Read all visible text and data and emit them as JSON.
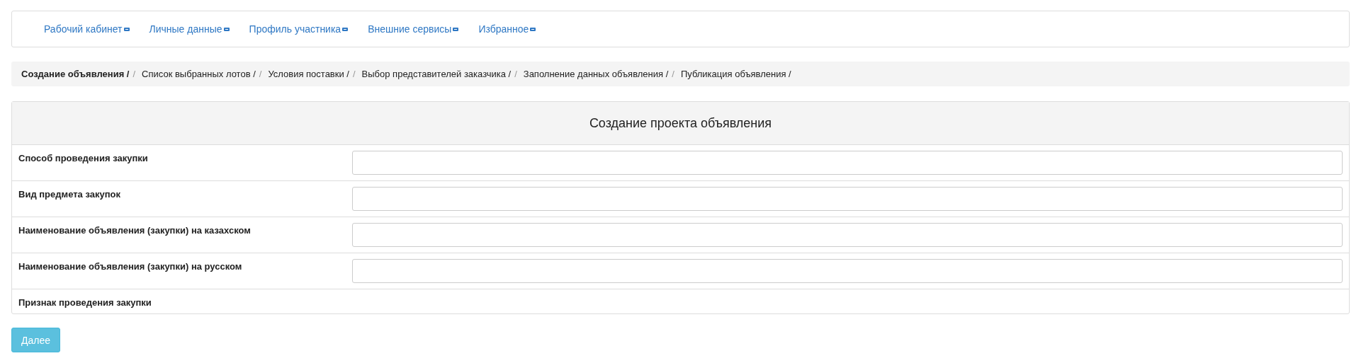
{
  "nav": {
    "items": [
      {
        "label": "Рабочий кабинет"
      },
      {
        "label": "Личные данные"
      },
      {
        "label": "Профиль участника"
      },
      {
        "label": "Внешние сервисы"
      },
      {
        "label": "Избранное"
      }
    ]
  },
  "breadcrumb": [
    {
      "label": "Создание объявления /",
      "selected": true,
      "separator": "/"
    },
    {
      "label": "Список выбранных лотов /",
      "selected": false,
      "separator": "/"
    },
    {
      "label": "Условия поставки /",
      "selected": false,
      "separator": "/"
    },
    {
      "label": "Выбор представителей заказчика /",
      "selected": false,
      "separator": "/"
    },
    {
      "label": "Заполнение данных объявления /",
      "selected": false,
      "separator": "/"
    },
    {
      "label": "Публикация объявления /",
      "selected": false
    }
  ],
  "panel": {
    "title": "Создание проекта объявления",
    "rows": [
      {
        "label": "Способ проведения закупки",
        "kind": "input"
      },
      {
        "label": "Вид предмета закупок",
        "kind": "input"
      },
      {
        "label": "Наименование объявления (закупки) на казахском",
        "kind": "input"
      },
      {
        "label": "Наименование объявления (закупки) на русском",
        "kind": "input"
      },
      {
        "label": "Признак проведения закупки",
        "kind": "text"
      }
    ]
  },
  "buttons": [
    {
      "label": "Далее"
    }
  ]
}
